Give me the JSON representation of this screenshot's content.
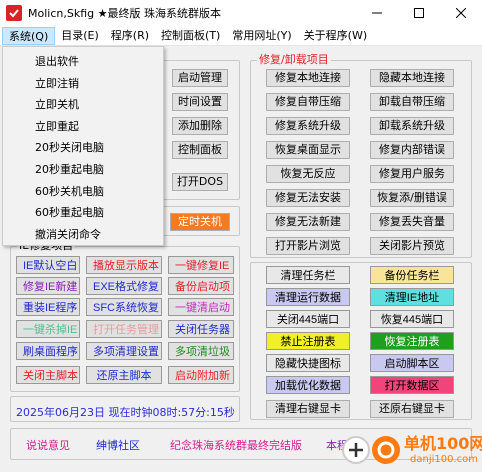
{
  "window": {
    "title": "Molicn,Skfig ★最终版 珠海系统群版本"
  },
  "menubar": {
    "items": [
      "系统(Q)",
      "目录(E)",
      "程序(R)",
      "控制面板(T)",
      "常用网址(Y)",
      "关于程序(W)"
    ]
  },
  "dropdown": {
    "items": [
      "退出软件",
      "立即注销",
      "立即关机",
      "立即重起",
      "20秒关闭电脑",
      "20秒重起电脑",
      "60秒关机电脑",
      "60秒重起电脑",
      "撤消关闭命令"
    ]
  },
  "left_buttons": {
    "startup_manager": "启动管理",
    "time_settings": "时间设置",
    "add_delete": "添加删除",
    "control_panel": "控制面板",
    "open_dos": "打开DOS",
    "scheduled_shutdown": "定时关机"
  },
  "ie_panel": {
    "legend": "IE修复项目",
    "cells": [
      [
        "IE默认空白",
        "播放显示版本",
        "一键修复IE"
      ],
      [
        "修复IE新建",
        "EXE格式修复",
        "备份启动项"
      ],
      [
        "重装IE程序",
        "SFC系统恢复",
        "一键清启动"
      ],
      [
        "一键杀掉IE",
        "打开任务管理",
        "关闭任务器"
      ],
      [
        "刷桌面程序",
        "多项清理设置",
        "多项清垃圾"
      ],
      [
        "关闭主脚本",
        "还原主脚本",
        "启动附加新"
      ]
    ]
  },
  "repair_panel": {
    "legend": "修复/卸载项目",
    "rows": [
      [
        "修复本地连接",
        "隐藏本地连接"
      ],
      [
        "修复自带压缩",
        "卸载自带压缩"
      ],
      [
        "修复系统升级",
        "卸载系统升级"
      ],
      [
        "恢复桌面显示",
        "修复内部错误"
      ],
      [
        "恢复无反应",
        "修复用户服务"
      ],
      [
        "修复无法安装",
        "恢复添/删错误"
      ],
      [
        "修复无法新建",
        "修复丢失音量"
      ],
      [
        "打开影片浏览",
        "关闭影片预览"
      ]
    ]
  },
  "tools_panel": {
    "cells": [
      [
        "清理任务栏",
        "备份任务栏"
      ],
      [
        "清理运行数据",
        "清理IE地址"
      ],
      [
        "关闭445端口",
        "恢复445端口"
      ],
      [
        "禁止注册表",
        "恢复注册表"
      ],
      [
        "隐藏快捷图标",
        "启动脚本区"
      ],
      [
        "加载优化数据",
        "打开数据区"
      ],
      [
        "清理右键显卡",
        "还原右键显卡"
      ]
    ]
  },
  "status": {
    "datetime": "2025年06月23日 现在时钟08时:57分:15秒"
  },
  "footer": {
    "feedback": "说说意见",
    "community": "绅博社区",
    "commemorate": "纪念珠海系统群最终完结版",
    "extra": "本程"
  },
  "watermark": {
    "brand": "单机100网",
    "url": "danji100.com"
  },
  "colors": {
    "red_text": "#e8202a",
    "blue_text": "#1e2bd0",
    "purple_text": "#8a1fb5",
    "orange_btn": "#f47a23",
    "green_text": "#1c8a1c"
  }
}
